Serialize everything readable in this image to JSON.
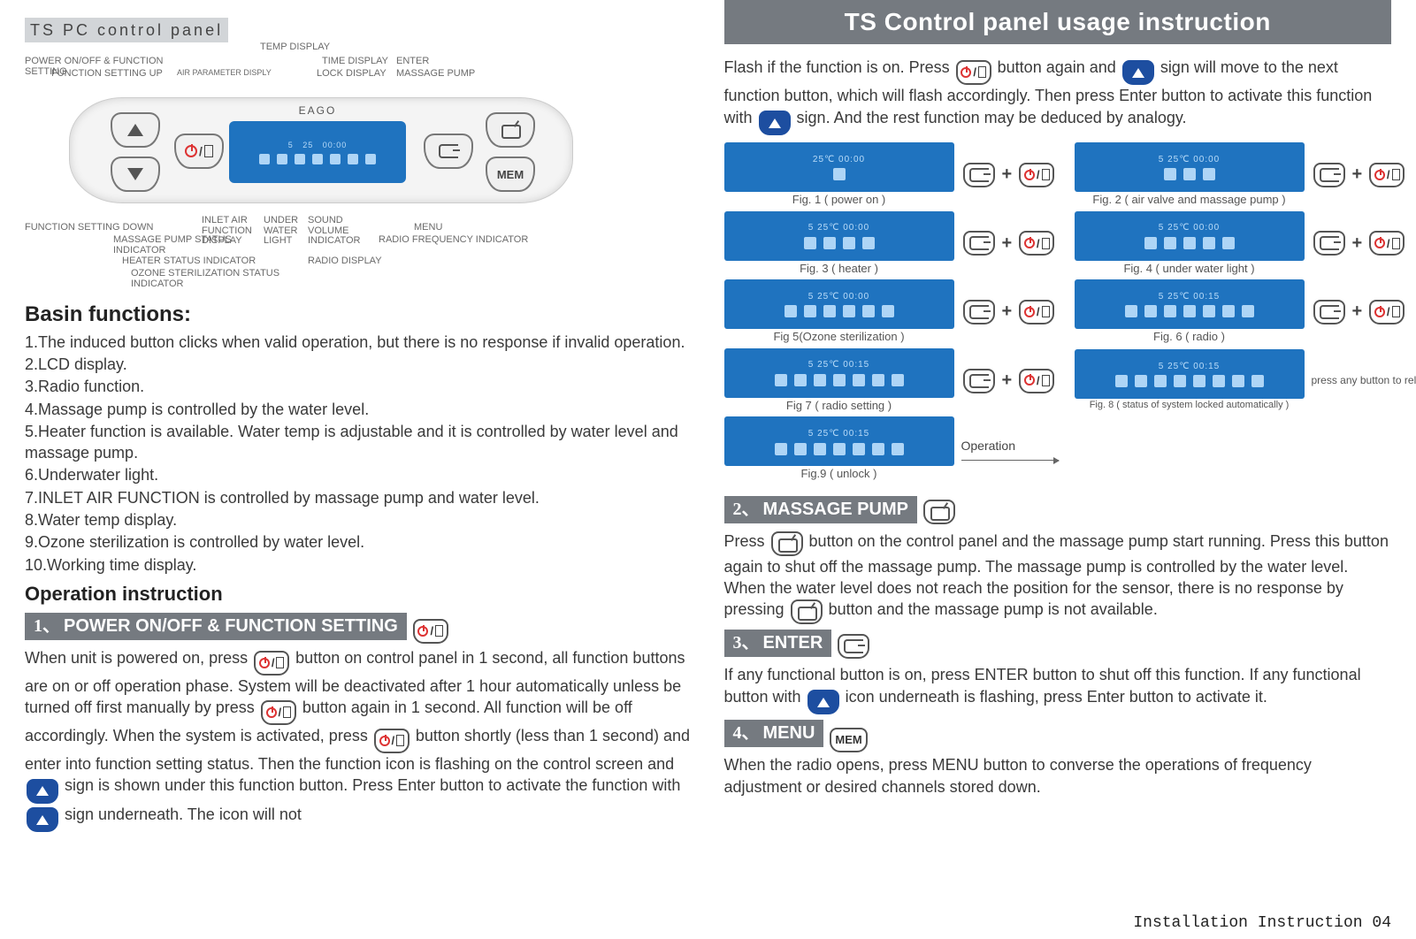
{
  "header": {
    "main_title": "TS Control panel usage instruction",
    "sub_title": "TS PC control panel"
  },
  "panel_labels": {
    "temp_display": "TEMP DISPLAY",
    "power_setting": "POWER ON/OFF & FUNCTION SETTING",
    "func_up": "FUNCTION SETTING UP",
    "air_param": "AIR PARAMETER DISPLY",
    "time_display": "TIME DISPLAY",
    "enter": "ENTER",
    "lock_display": "LOCK DISPLAY",
    "massage_pump_btn": "MASSAGE PUMP",
    "brand": "EAGO",
    "mem": "MEM",
    "func_down": "FUNCTION SETTING DOWN",
    "inlet_air": "INLET AIR FUNCTION DISPLAY",
    "under_water": "UNDER WATER LIGHT",
    "sound_vol": "SOUND VOLUME INDICATOR",
    "menu": "MENU",
    "massage_status": "MASSAGE PUMP STATUS INDICATOR",
    "heater_status": "HEATER STATUS INDICATOR",
    "ozone_status": "OZONE STERILIZATION STATUS INDICATOR",
    "radio_display": "RADIO DISPLAY",
    "radio_freq": "RADIO FREQUENCY INDICATOR"
  },
  "basin": {
    "heading": "Basin functions:",
    "items": [
      "1.The induced button clicks when valid operation, but there is no response if invalid operation.",
      "2.LCD display.",
      "3.Radio function.",
      "4.Massage pump is controlled by the water level.",
      "5.Heater function is available. Water temp is adjustable and it is controlled by water level and massage pump.",
      "6.Underwater light.",
      "7.INLET AIR FUNCTION is controlled by massage pump and water level.",
      "8.Water temp display.",
      "9.Ozone sterilization is controlled by water level.",
      "10.Working time display."
    ]
  },
  "op": {
    "heading": "Operation instruction",
    "sec1_title": "POWER ON/OFF & FUNCTION SETTING",
    "sec1_num": "1、",
    "sec1_text_a": "When unit is powered on, press",
    "sec1_text_b": "button on control panel in 1 second, all function buttons are on or off operation phase. System will be deactivated after 1 hour automatically unless be turned off first manually by press",
    "sec1_text_c": "button again in 1 second. All function will be off accordingly. When the system is activated, press",
    "sec1_text_d": "button shortly (less than 1 second) and enter into function setting status. Then the function icon is flashing on the control screen and",
    "sec1_text_e": "sign is shown under this function button. Press Enter button to activate the function with",
    "sec1_text_f": "sign underneath. The icon will not"
  },
  "right_intro": {
    "a": "Flash if the function is on. Press",
    "b": "button again and",
    "c": "sign will move to the next function button, which will flash accordingly. Then press Enter button to activate this function with",
    "d": "sign. And the rest function may be deduced by analogy."
  },
  "figs": [
    {
      "cap": "Fig. 1 ( power on )",
      "top": "25℃  00:00"
    },
    {
      "cap": "Fig. 2 ( air valve and massage pump )",
      "top": "5   25℃  00:00"
    },
    {
      "cap": "Fig. 3 ( heater )",
      "top": "5   25℃  00:00"
    },
    {
      "cap": "Fig. 4 ( under water light )",
      "top": "5   25℃  00:00"
    },
    {
      "cap": "Fig 5(Ozone sterilization )",
      "top": "5   25℃  00:00"
    },
    {
      "cap": "Fig. 6 ( radio )",
      "top": "5   25℃  00:15"
    },
    {
      "cap": "Fig 7 ( radio setting )",
      "top": "5   25℃  00:15"
    },
    {
      "cap": "Fig. 8 ( status of system locked automatically )",
      "top": "5   25℃  00:15",
      "note": "press any button to release"
    },
    {
      "cap": "Fig.9 ( unlock )",
      "top": "5   25℃  00:15",
      "side": "Operation"
    }
  ],
  "sec2": {
    "num": "2、",
    "title": "MASSAGE PUMP",
    "text_a": "Press",
    "text_b": "button on the control panel and the massage pump start running. Press this button again to shut off the massage pump. The massage pump is controlled by the water level. When the water level does not reach the position for the sensor, there is no response by pressing",
    "text_c": "button and the massage pump is not available."
  },
  "sec3": {
    "num": "3、",
    "title": "ENTER",
    "text_a": "If any functional button is on, press ENTER button to shut off this function. If any functional button with",
    "text_b": "icon underneath is flashing, press Enter button to activate it."
  },
  "sec4": {
    "num": "4、",
    "title": "MENU",
    "mem": "MEM",
    "text": "When the radio opens, press MENU button to converse the operations of frequency adjustment or desired channels stored down."
  },
  "footer": "Installation Instruction 04"
}
